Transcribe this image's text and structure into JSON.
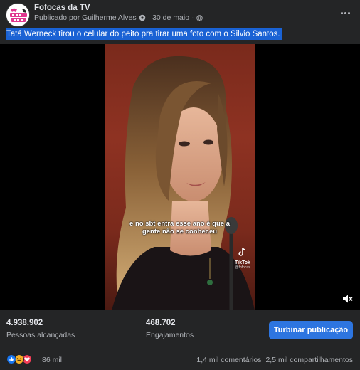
{
  "post": {
    "page_name": "Fofocas da TV",
    "published_by": "Publicado por Guilherme Alves",
    "date": "30 de maio",
    "separator": "·",
    "caption": "Tatá Werneck tirou o celular do peito pra tirar uma foto com o Silvio Santos."
  },
  "video": {
    "subtitle_line1": "e no sbt entra esse ano é que a",
    "subtitle_line2": "gente não se conheceu",
    "watermark": "TikTok",
    "watermark_handle": "@fofocas"
  },
  "stats": {
    "reach_value": "4.938.902",
    "reach_label": "Pessoas alcançadas",
    "engagement_value": "468.702",
    "engagement_label": "Engajamentos",
    "boost_label": "Turbinar publicação"
  },
  "reactions": {
    "icons": [
      "like-icon",
      "haha-icon",
      "love-icon"
    ],
    "count": "86 mil",
    "comments": "1,4 mil comentários",
    "shares": "2,5 mil compartilhamentos"
  },
  "colors": {
    "background": "#242526",
    "highlight": "#1a62d4",
    "boost_button": "#2d75e0",
    "like": "#1877f2",
    "haha": "#f7b125",
    "love": "#f33e58"
  }
}
